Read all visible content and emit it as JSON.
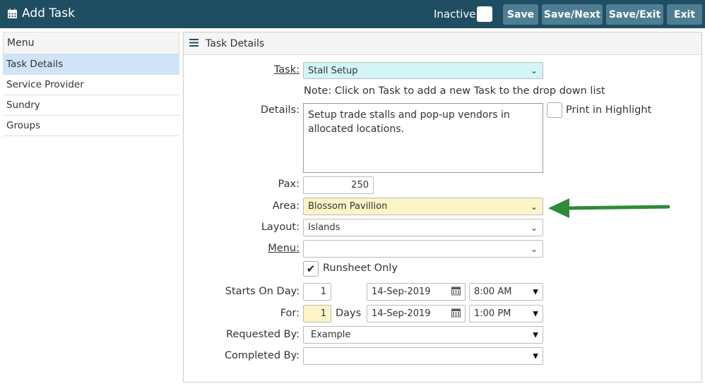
{
  "header": {
    "title": "Add Task",
    "inactive_label": "Inactive",
    "buttons": {
      "save": "Save",
      "save_next": "Save/Next",
      "save_exit": "Save/Exit",
      "exit": "Exit"
    }
  },
  "sidebar": {
    "heading": "Menu",
    "items": [
      {
        "label": "Task Details"
      },
      {
        "label": "Service Provider"
      },
      {
        "label": "Sundry"
      },
      {
        "label": "Groups"
      }
    ]
  },
  "panel": {
    "heading": "Task Details",
    "task": {
      "label": "Task:",
      "value": "Stall Setup",
      "note": "Note: Click on Task to add a new Task to the drop down list"
    },
    "details": {
      "label": "Details:",
      "value": "Setup trade stalls and pop-up vendors in allocated locations.",
      "print_highlight_label": "Print in Highlight"
    },
    "pax": {
      "label": "Pax:",
      "value": "250"
    },
    "area": {
      "label": "Area:",
      "value": "Blossom Pavillion"
    },
    "layout": {
      "label": "Layout:",
      "value": "Islands"
    },
    "menu": {
      "label": "Menu:",
      "value": ""
    },
    "runsheet": {
      "label": "Runsheet Only",
      "checked": true
    },
    "starts": {
      "label": "Starts On Day:",
      "day": "1",
      "date": "14-Sep-2019",
      "time": "8:00 AM"
    },
    "for": {
      "label": "For:",
      "days": "1",
      "days_label": "Days",
      "date": "14-Sep-2019",
      "time": "1:00 PM"
    },
    "requested_by": {
      "label": "Requested By:",
      "value": "Example"
    },
    "completed_by": {
      "label": "Completed By:",
      "value": ""
    }
  },
  "colors": {
    "header_bg": "#1f4e63",
    "button_bg": "#4f7e93",
    "arrow": "#2e8b3a",
    "task_field": "#d3f5f8",
    "area_field": "#fdf4c8",
    "active_menu": "#cfe5f7"
  },
  "icons": [
    "calendar-icon",
    "hamburger-icon",
    "chevron-down-icon",
    "caret-down-icon",
    "checkmark-icon",
    "arrow-left-icon"
  ]
}
